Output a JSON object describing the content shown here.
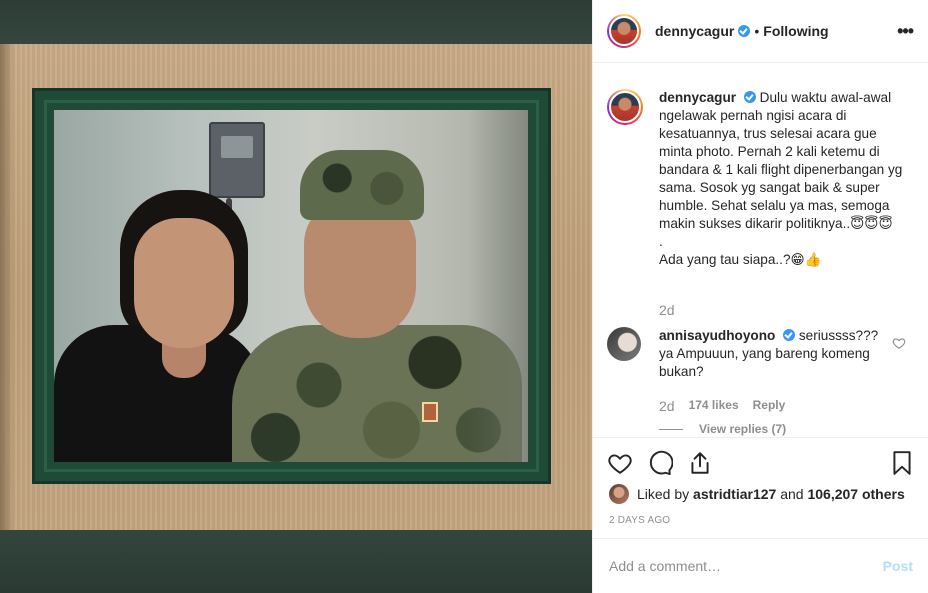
{
  "post": {
    "username": "dennycagur",
    "separator": "•",
    "follow_status": "Following",
    "more": "•••"
  },
  "caption": {
    "username": "dennycagur",
    "text": "Dulu waktu awal-awal ngelawak pernah ngisi acara di kesatuannya, trus selesai acara gue minta photo. Pernah 2 kali ketemu di bandara & 1 kali flight dipenerbangan yg sama. Sosok yg sangat baik & super humble. Sehat selalu ya mas, semoga makin sukses dikarir politiknya..😇😇😇",
    "dot": ".",
    "question": "Ada yang tau siapa..?😁👍",
    "time": "2d"
  },
  "comment": {
    "username": "annisayudhoyono",
    "text": "seriussss??? ya Ampuuun, yang bareng komeng bukan?",
    "time": "2d",
    "likes": "174 likes",
    "reply": "Reply",
    "view_replies": "View replies (7)"
  },
  "likes_line": {
    "prefix": "Liked by",
    "user": "astridtiar127",
    "conj": "and",
    "others": "106,207 others"
  },
  "date": "2 DAYS AGO",
  "add_comment": {
    "placeholder": "Add a comment…",
    "post_label": "Post"
  },
  "colors": {
    "verified": "#3897f0",
    "post_disabled": "#b2dffc",
    "muted": "#8e8e8e"
  }
}
